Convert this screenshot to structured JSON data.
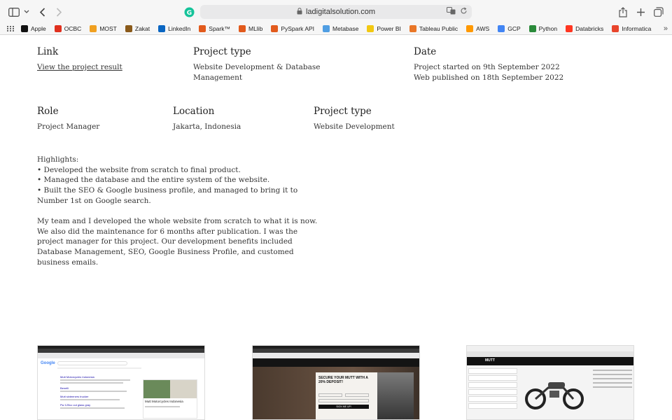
{
  "browser": {
    "url": "ladigitalsolution.com",
    "bookmarks": [
      {
        "label": "Apple",
        "icon": "apple-icon",
        "color": "#111111"
      },
      {
        "label": "OCBC",
        "icon": "ocbc-icon",
        "color": "#e0301e"
      },
      {
        "label": "MOST",
        "icon": "most-icon",
        "color": "#f0a020"
      },
      {
        "label": "Zakat",
        "icon": "zakat-icon",
        "color": "#8a5a1a"
      },
      {
        "label": "LinkedIn",
        "icon": "linkedin-icon",
        "color": "#0a66c2"
      },
      {
        "label": "Spark™",
        "icon": "spark-icon",
        "color": "#e25a1c"
      },
      {
        "label": "MLlib",
        "icon": "mllib-icon",
        "color": "#e25a1c"
      },
      {
        "label": "PySpark API",
        "icon": "pyspark-icon",
        "color": "#e25a1c"
      },
      {
        "label": "Metabase",
        "icon": "metabase-icon",
        "color": "#509ee3"
      },
      {
        "label": "Power BI",
        "icon": "powerbi-icon",
        "color": "#f2c811"
      },
      {
        "label": "Tableau Public",
        "icon": "tableau-icon",
        "color": "#e97627"
      },
      {
        "label": "AWS",
        "icon": "aws-icon",
        "color": "#ff9900"
      },
      {
        "label": "GCP",
        "icon": "gcp-icon",
        "color": "#4285f4"
      },
      {
        "label": "Python",
        "icon": "python-icon",
        "color": "#2a8a3a"
      },
      {
        "label": "Databricks",
        "icon": "databricks-icon",
        "color": "#ff3621"
      },
      {
        "label": "Informatica",
        "icon": "informatica-icon",
        "color": "#e8452c"
      }
    ]
  },
  "project": {
    "row1": {
      "link_heading": "Link",
      "link_text": "View the project result",
      "type_heading": "Project type",
      "type_value": "Website Development & Database Management",
      "date_heading": "Date",
      "date_line1": "Project started on 9th September 2022",
      "date_line2": "Web published on 18th September 2022"
    },
    "row2": {
      "role_heading": "Role",
      "role_value": "Project Manager",
      "location_heading": "Location",
      "location_value": "Jakarta, Indonesia",
      "type_heading": "Project type",
      "type_value": "Website Development"
    },
    "highlights": {
      "title": "Highlights:",
      "items": [
        "• Developed the website from scratch to final product.",
        "• Managed the database and the entire system of the website.",
        "• Built the SEO & Google business profile, and managed to bring it to Number 1st on Google search."
      ]
    },
    "description": "My team and I developed the whole website from scratch to what it is now. We also did the maintenance for 6 months after publication. I was the project manager for this project. Our development benefits included Database Management, SEO, Google Business Profile, and customed business emails."
  },
  "screenshots": {
    "google": {
      "search_logo": "Google",
      "result1": "Mutt Motorcycles Indonesia",
      "result2": "Benelli",
      "result3": "Mutt sixteeners trucker",
      "result4": "Pw 125cc cut glass gray",
      "panel_title": "Mutt Motorcycles Indonesia"
    },
    "promo": {
      "headline": "SECURE YOUR MUTT WITH A 20% DEPOSIT!",
      "button": "SIGN ME UP!"
    },
    "catalog": {
      "brand": "MUTT"
    }
  }
}
